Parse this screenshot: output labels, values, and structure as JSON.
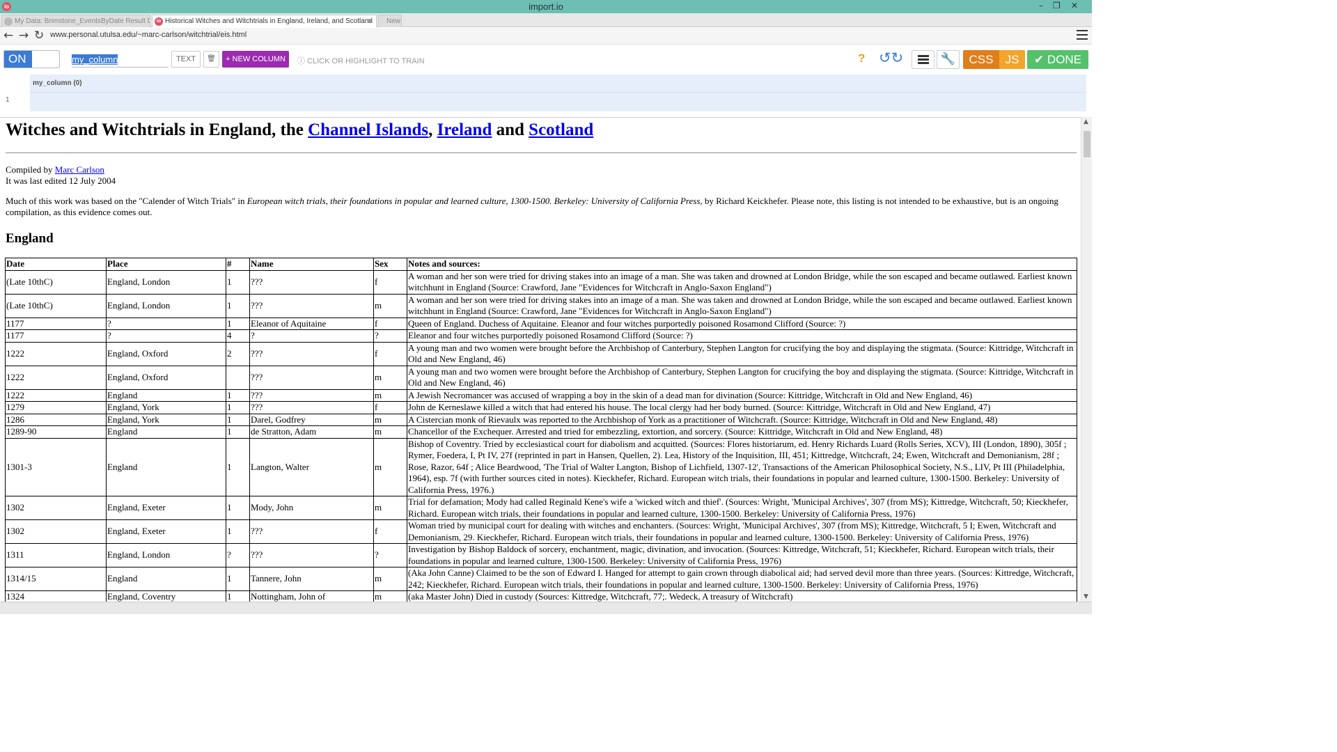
{
  "window": {
    "title": "import.io",
    "logo": "io",
    "minimize": "–",
    "restore": "❐",
    "close": "✕"
  },
  "tabs": [
    {
      "label": "My Data: Brimstone_EventsByDate Result Data",
      "state": "inactive"
    },
    {
      "label": "Historical Witches and Witchtrials in England, Ireland, and Scotland",
      "state": "active",
      "close": "✕"
    },
    {
      "label": "New",
      "state": "inactive"
    }
  ],
  "address": {
    "back": "←",
    "forward": "→",
    "reload": "↻",
    "url": "www.personal.utulsa.edu/~marc-carlson/witchtrial/eis.html"
  },
  "toolbar": {
    "toggle": "ON",
    "column_name": "my_column",
    "text_label": "TEXT",
    "trash": "🗑",
    "new_column": "+ NEW COLUMN",
    "hint": "ⓘ CLICK OR HIGHLIGHT TO TRAIN",
    "help": "?",
    "undo_redo": "↺↻",
    "wrench": "🔧",
    "css": "CSS",
    "js": "JS",
    "done": "✔ DONE"
  },
  "colpanel": {
    "header": "my_column (0)",
    "row_number": "1"
  },
  "page": {
    "title_prefix": "Witches and Witchtrials in England, the ",
    "links": [
      "Channel Islands",
      "Ireland",
      "Scotland"
    ],
    "title_and": " and ",
    "compiled_by": "Compiled by ",
    "author": "Marc Carlson",
    "last_edited": "It was last edited 12 July 2004",
    "intro_a": "Much of this work was based on the \"Calender of Witch Trials\" in ",
    "intro_book": "European witch trials, their foundations in popular and learned culture, 1300-1500.  Berkeley: University of California Press,",
    "intro_b": " by Richard Keickhefer.  Please note, this listing is not intended to be exhaustive, but is an ongoing compilation, as this evidence comes out.",
    "section": "England"
  },
  "table": {
    "headers": [
      "Date",
      "Place",
      "#",
      "Name",
      "Sex",
      "Notes and sources:"
    ],
    "rows": [
      [
        "(Late 10thC)",
        "England, London",
        "1",
        "???",
        "f",
        "A woman and her son were tried for driving stakes into an image of a man.  She was taken and drowned at London Bridge, while the son escaped and became outlawed.   Earliest known witchhunt in England (Source: Crawford, Jane  \"Evidences for Witchcraft in Anglo-Saxon England\")"
      ],
      [
        "(Late 10thC)",
        "England, London",
        "1",
        "???",
        "m",
        "A woman and her son were tried for driving stakes into an image of a man.  She was taken and drowned at London Bridge, while the son escaped and became outlawed.   Earliest known witchhunt in England (Source: Crawford, Jane  \"Evidences for Witchcraft in Anglo-Saxon England\")"
      ],
      [
        "1177",
        "?",
        "1",
        "Eleanor of Aquitaine",
        "f",
        "Queen of England.  Duchess of Aquitaine. Eleanor and four witches purportedly poisoned Rosamond Clifford (Source: ?)"
      ],
      [
        "1177",
        "?",
        "4",
        "?",
        "?",
        "Eleanor and four witches purportedly poisoned Rosamond Clifford (Source: ?)"
      ],
      [
        "1222",
        "England, Oxford",
        "2",
        "???",
        "f",
        "A young man and two women were brought before the Archbishop of Canterbury, Stephen Langton for crucifying the boy and displaying the stigmata. (Source: Kittridge, Witchcraft in Old and New England, 46)"
      ],
      [
        "1222",
        "England, Oxford",
        "",
        "???",
        "m",
        "A young man and two women were brought before the Archbishop of Canterbury, Stephen Langton for crucifying the boy and displaying the stigmata. (Source: Kittridge, Witchcraft in Old and New England, 46)"
      ],
      [
        "1222",
        "England",
        "1",
        "???",
        "m",
        "A Jewish Necromancer was accused of wrapping a boy in the skin of a dead man for divination (Source: Kittridge, Witchcraft in Old and New England, 46)"
      ],
      [
        "1279",
        "England, York",
        "1",
        "???",
        "f",
        "John de Kerneslawe killed a witch that had entered his house.  The local clergy had her body burned. (Source: Kittridge, Witchcraft in Old and New England, 47)"
      ],
      [
        "1286",
        "England, York",
        "1",
        "Darel, Godfrey",
        "m",
        "A Cistercian monk of Rievaulx was reported to the Archbishop of York as a practitioner of Witchcraft. (Source: Kittridge, Witchcraft in Old and New England, 48)"
      ],
      [
        "1289-90",
        "England",
        "1",
        "de Stratton, Adam",
        "m",
        "Chancellor of the Exchequer.  Arrested and tried for embezzling, extortion, and sorcery. (Source: Kittridge, Witchcraft in Old and New England, 48)"
      ],
      [
        "1301-3",
        "England",
        "1",
        "Langton, Walter",
        "m",
        "Bishop of Coventry.  Tried by ecclesiastical court for diabolism and acquitted.   (Sources: Flores historiarum, ed.  Henry Richards Luard (Rolls Series, XCV), III (London, 1890), 305f ; Rymer, Foedera, I, Pt IV, 27f (reprinted in part in Hansen, Quellen, 2). Lea, History of the Inquisition, III, 451; Kittredge, Witchcraft, 24; Ewen, Witchcraft and Demonianism, 28f ; Rose, Razor, 64f ; Alice Beardwood, 'The Trial of Walter Langton, Bishop of Lichfield, 1307-12', Transactions of the American Philosophical Society, N.S., LIV, Pt III (Philadelphia, 1964), esp. 7f (with further sources cited in notes).    Kieckhefer, Richard.  European witch trials, their foundations in popular and learned culture, 1300-1500.  Berkeley: University of California Press, 1976.)"
      ],
      [
        "1302",
        "England, Exeter",
        "1",
        "Mody, John",
        "m",
        "Trial for defamation;   Mody had called Reginald Kene's wife a 'wicked witch and thief'.  (Sources: Wright, 'Municipal Archives', 307 (from MS); Kittredge, Witchcraft, 50; Kieckhefer, Richard.  European witch trials, their foundations in popular and learned culture, 1300-1500.  Berkeley: University of California Press, 1976)"
      ],
      [
        "1302",
        "England, Exeter",
        "1",
        "???",
        "f",
        "Woman tried by municipal court for dealing with witches and enchanters.  (Sources:   Wright, 'Municipal Archives', 307 (from MS); Kittredge, Witchcraft, 5 I; Ewen, Witchcraft and Demonianism, 29.    Kieckhefer, Richard.  European witch trials, their foundations in popular and learned culture, 1300-1500.  Berkeley: University of California Press, 1976)"
      ],
      [
        "1311",
        "England, London",
        "?",
        "???",
        "?",
        "Investigation by Bishop Baldock of sorcery, enchantment, magic, divination, and invocation. (Sources: Kittredge, Witchcraft, 51; Kieckhefer, Richard. European witch trials, their foundations in popular and learned culture, 1300-1500.  Berkeley: University of California Press, 1976)"
      ],
      [
        "1314/15",
        "England",
        "1",
        "Tannere, John",
        "m",
        "(Aka John Canne) Claimed to be the son of Edward I.  Hanged for attempt to gain crown through diabolical aid; had served devil more than three years. (Sources: Kittredge, Witchcraft, 242; Kieckhefer, Richard. European witch trials, their foundations in popular and learned culture, 1300-1500.  Berkeley: University of California Press, 1976)"
      ],
      [
        "1324",
        "England, Coventry",
        "1",
        "Nottingham, John of",
        "m",
        "(aka Master John) Died in custody  (Sources: Kittredge, Witchcraft, 77;. Wedeck, A treasury of Witchcraft)"
      ]
    ]
  }
}
